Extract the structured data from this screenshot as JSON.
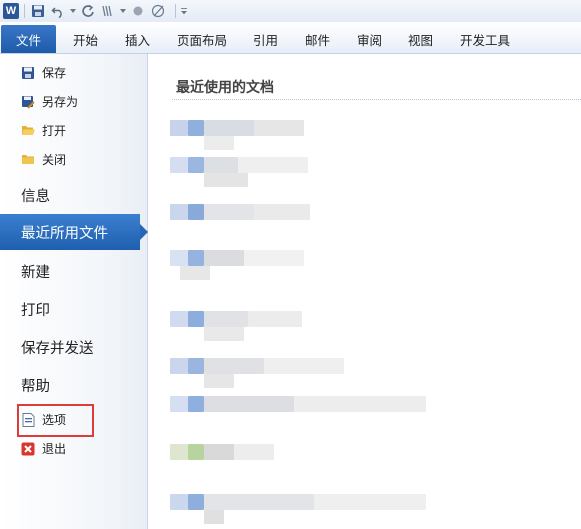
{
  "app": {
    "logo_letter": "W"
  },
  "ribbon": {
    "tabs": [
      {
        "label": "文件"
      },
      {
        "label": "开始"
      },
      {
        "label": "插入"
      },
      {
        "label": "页面布局"
      },
      {
        "label": "引用"
      },
      {
        "label": "邮件"
      },
      {
        "label": "审阅"
      },
      {
        "label": "视图"
      },
      {
        "label": "开发工具"
      }
    ]
  },
  "backstage": {
    "small_items": [
      {
        "label": "保存",
        "icon": "save-icon"
      },
      {
        "label": "另存为",
        "icon": "save-as-icon"
      },
      {
        "label": "打开",
        "icon": "open-folder-icon"
      },
      {
        "label": "关闭",
        "icon": "close-folder-icon"
      }
    ],
    "large_items": [
      {
        "label": "信息"
      },
      {
        "label": "最近所用文件"
      },
      {
        "label": "新建"
      },
      {
        "label": "打印"
      },
      {
        "label": "保存并发送"
      },
      {
        "label": "帮助"
      }
    ],
    "bottom_items": [
      {
        "label": "选项",
        "icon": "options-icon"
      },
      {
        "label": "退出",
        "icon": "exit-icon"
      }
    ]
  },
  "recent": {
    "title": "最近使用的文档"
  },
  "colors": {
    "file_tab": "#1e5aa8",
    "active_menu": "#2766b6",
    "highlight": "#e03b3b"
  }
}
